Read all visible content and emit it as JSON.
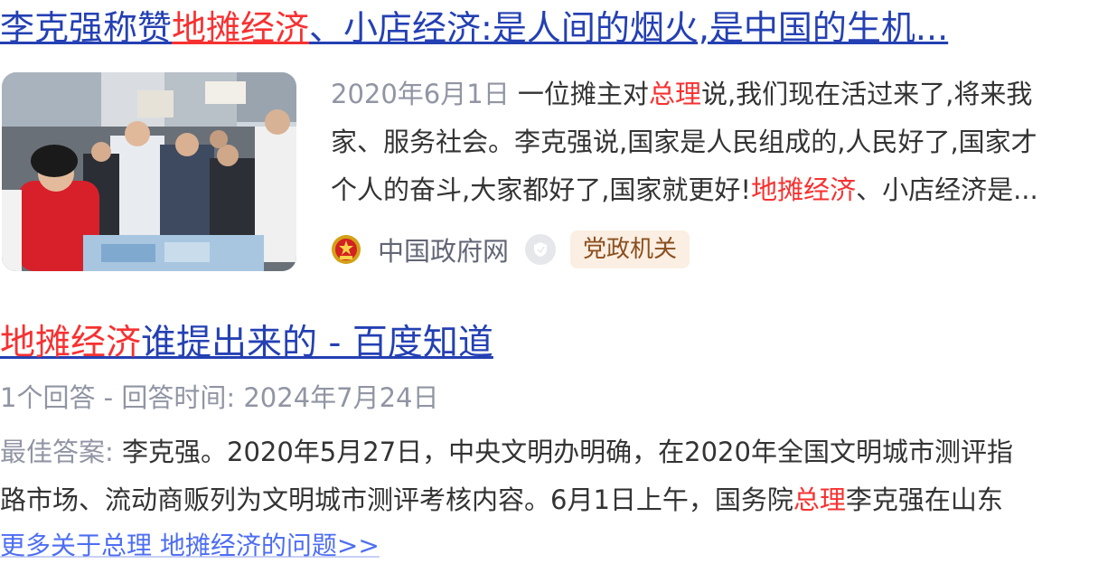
{
  "result1": {
    "title": {
      "part1": "李克强称赞",
      "highlight": "地摊经济",
      "part2": "、小店经济:是人间的烟火,是中国的生机..."
    },
    "abstract": {
      "date": "2020年6月1日",
      "line1_pre": " 一位摊主对",
      "line1_hl": "总理",
      "line1_post": "说,我们现在活过来了,将来我",
      "line2": "家、服务社会。李克强说,国家是人民组成的,人民好了,国家才",
      "line3_pre": "个人的奋斗,大家都好了,国家就更好!",
      "line3_hl": "地摊经济",
      "line3_post": "、小店经济是..."
    },
    "source": {
      "name": "中国政府网",
      "tag": "党政机关",
      "emblem_icon": "national-emblem-icon",
      "verified_icon": "shield-icon"
    }
  },
  "result2": {
    "title": {
      "highlight": "地摊经济",
      "rest": "谁提出来的 - 百度知道"
    },
    "meta": "1个回答 - 回答时间: 2024年7月24日",
    "abstract": {
      "label": "最佳答案:",
      "line1": " 李克强。2020年5月27日，中央文明办明确，在2020年全国文明城市测评指",
      "line2_pre": "路市场、流动商贩列为文明城市测评考核内容。6月1日上午，国务院",
      "line2_hl": "总理",
      "line2_post": "李克强在山东"
    },
    "more_link": "更多关于总理 地摊经济的问题>>"
  },
  "colors": {
    "title_link": "#2440b3",
    "highlight": "#f73131",
    "muted": "#9195a3",
    "body": "#333333",
    "more_link": "#4e6ef2",
    "tag_bg": "#fbeee2",
    "tag_text": "#8a4f1f"
  }
}
